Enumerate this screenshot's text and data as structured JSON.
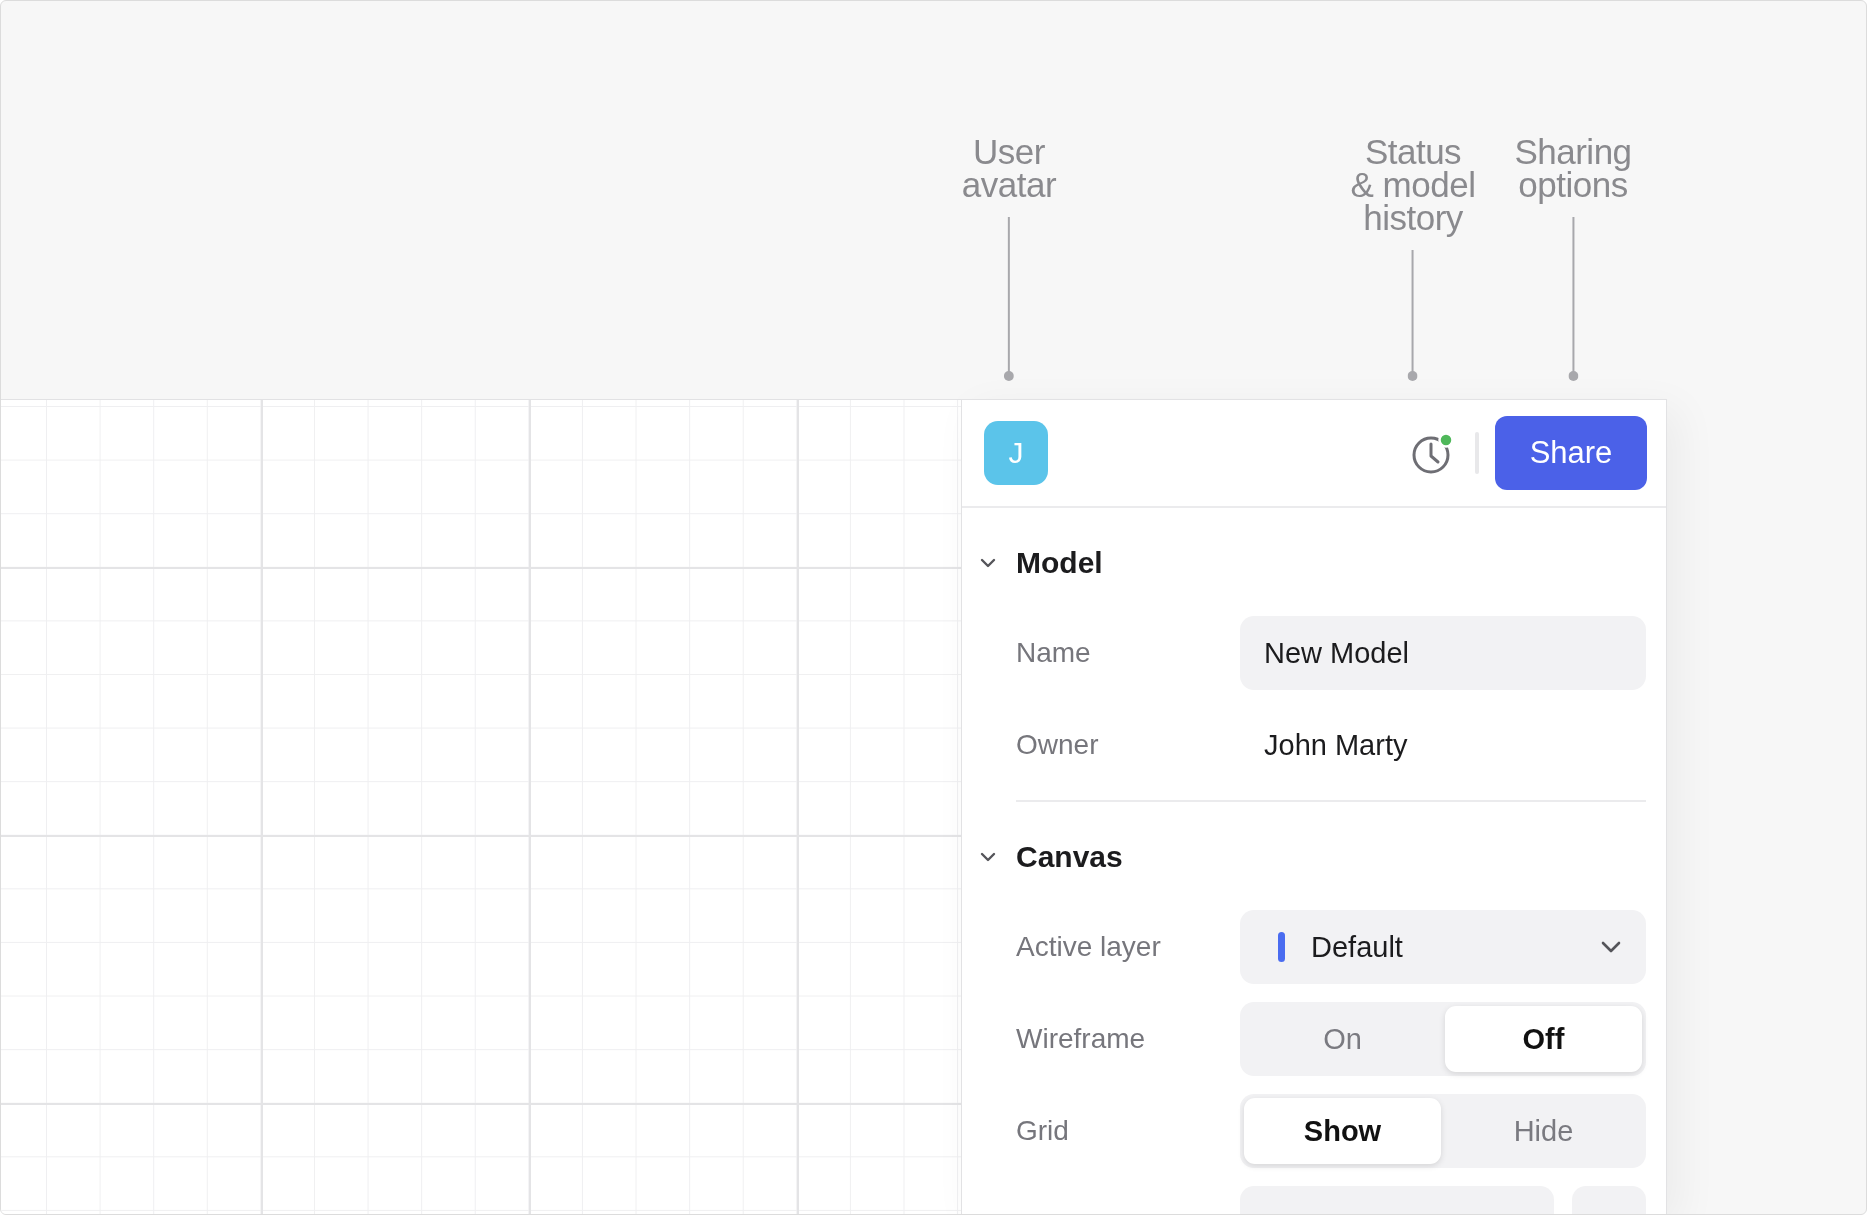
{
  "callouts": [
    {
      "text": "User\navatar",
      "kind": "avatar"
    },
    {
      "text": "Status\n& model\nhistory",
      "kind": "history"
    },
    {
      "text": "Sharing\noptions",
      "kind": "share"
    }
  ],
  "panel": {
    "avatar_initial": "J",
    "history_status_dot": true,
    "share_button": "Share",
    "sections": [
      {
        "title": "Model",
        "expanded": true,
        "rows": [
          {
            "kind": "input",
            "label": "Name",
            "value": "New Model"
          },
          {
            "kind": "text",
            "label": "Owner",
            "value": "John Marty"
          }
        ]
      },
      {
        "title": "Canvas",
        "expanded": true,
        "rows": [
          {
            "kind": "select",
            "label": "Active layer",
            "value": "Default",
            "color": "#4a6cf0"
          },
          {
            "kind": "segmented",
            "label": "Wireframe",
            "options": [
              {
                "label": "On",
                "selected": false
              },
              {
                "label": "Off",
                "selected": true
              }
            ]
          },
          {
            "kind": "segmented",
            "label": "Grid",
            "options": [
              {
                "label": "Show",
                "selected": true
              },
              {
                "label": "Hide",
                "selected": false
              }
            ]
          },
          {
            "kind": "cut-off"
          }
        ]
      }
    ]
  }
}
